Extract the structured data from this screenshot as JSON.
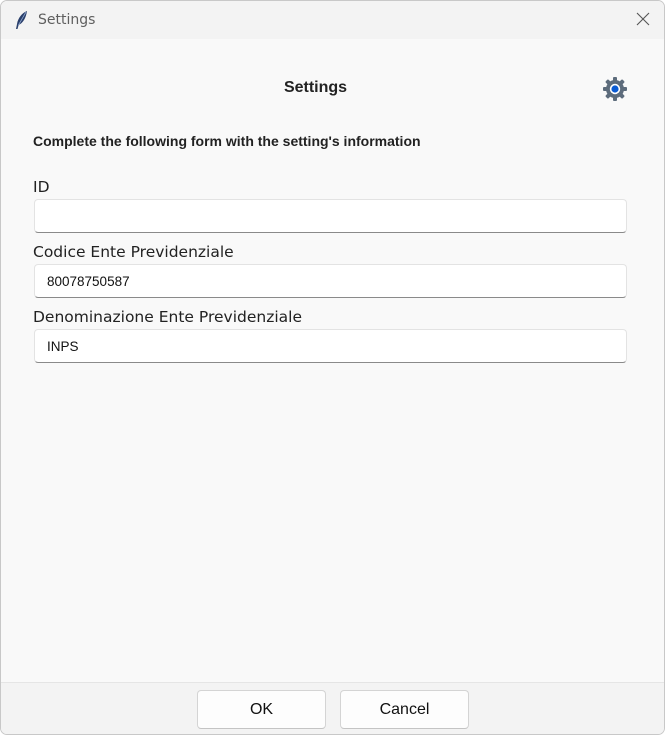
{
  "window": {
    "title": "Settings"
  },
  "header": {
    "title": "Settings"
  },
  "form": {
    "instructions": "Complete the following form with the setting's information",
    "fields": [
      {
        "label": "ID",
        "value": ""
      },
      {
        "label": "Codice Ente Previdenziale",
        "value": "80078750587"
      },
      {
        "label": "Denominazione Ente Previdenziale",
        "value": "INPS"
      }
    ]
  },
  "footer": {
    "ok_label": "OK",
    "cancel_label": "Cancel"
  },
  "icons": {
    "app": "feather-icon",
    "settings": "gear-icon",
    "close": "close-icon"
  },
  "colors": {
    "gear_accent": "#0a5bd3",
    "gear_body": "#5d6c7c"
  }
}
